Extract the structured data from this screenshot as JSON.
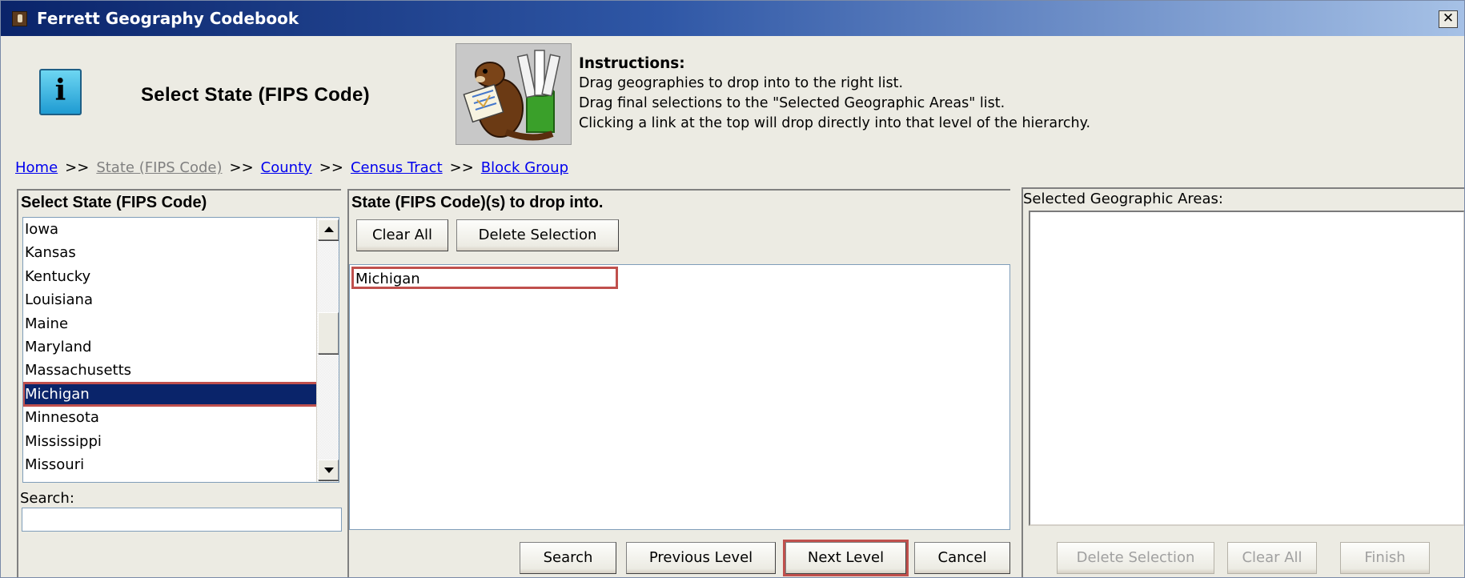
{
  "window": {
    "title": "Ferrett Geography Codebook"
  },
  "header": {
    "title": "Select State (FIPS Code)",
    "instructions": {
      "heading": "Instructions:",
      "lines": [
        "Drag geographies to drop into to the right list.",
        "Drag final selections to the \"Selected Geographic Areas\" list.",
        "Clicking a link at the top will drop directly into that level of the hierarchy."
      ]
    }
  },
  "breadcrumb": {
    "items": [
      "Home",
      "State (FIPS Code)",
      "County",
      "Census Tract",
      "Block Group"
    ],
    "separator": ">>",
    "current": "State (FIPS Code)"
  },
  "left_panel": {
    "title": "Select State (FIPS Code)",
    "items": [
      "Iowa",
      "Kansas",
      "Kentucky",
      "Louisiana",
      "Maine",
      "Maryland",
      "Massachusetts",
      "Michigan",
      "Minnesota",
      "Mississippi",
      "Missouri"
    ],
    "selected": "Michigan",
    "search_label": "Search:",
    "search_value": ""
  },
  "middle_panel": {
    "title": "State (FIPS Code)(s) to drop into.",
    "clear_all": "Clear All",
    "delete_selection": "Delete Selection",
    "items": [
      "Michigan"
    ],
    "buttons": {
      "search": "Search",
      "previous": "Previous Level",
      "next": "Next Level",
      "cancel": "Cancel"
    }
  },
  "right_panel": {
    "title": "Selected Geographic Areas:",
    "buttons": {
      "delete_selection": "Delete Selection",
      "clear_all": "Clear All",
      "finish": "Finish"
    }
  },
  "colors": {
    "selection": "#0a246a",
    "highlight_box": "#c0504d",
    "link": "#0000ee"
  }
}
